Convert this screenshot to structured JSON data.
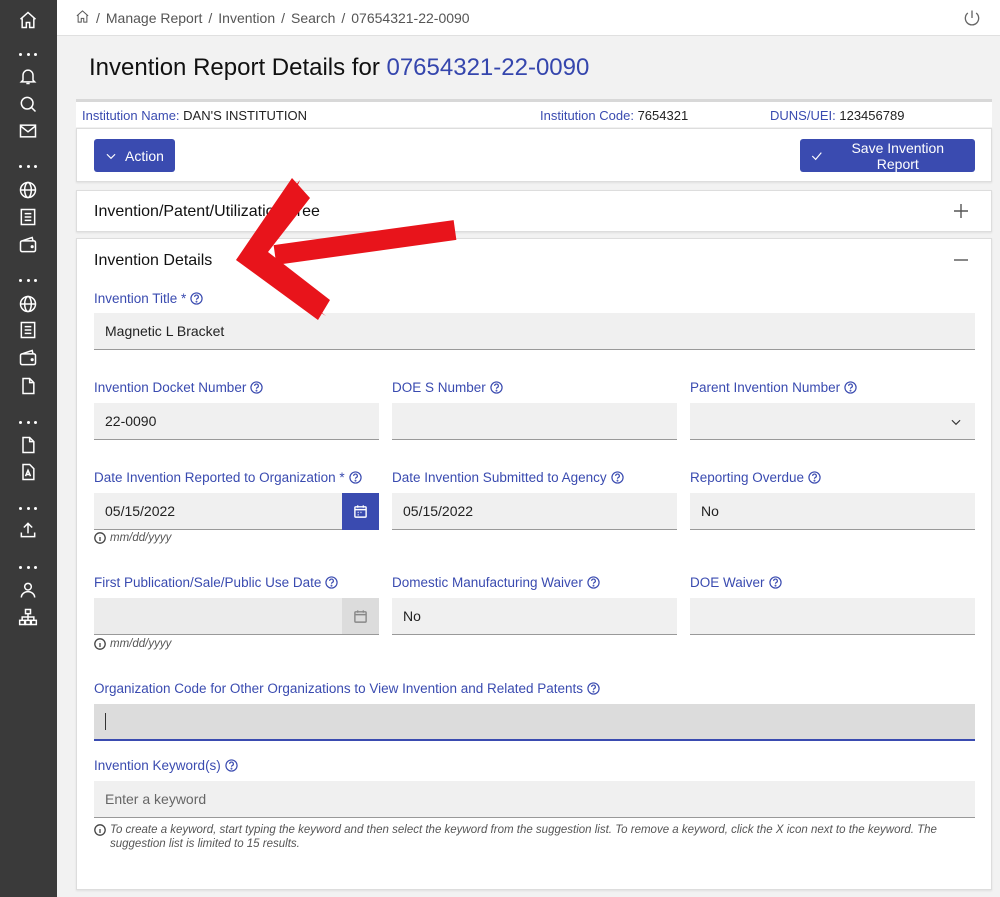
{
  "sidebar": {
    "icons": [
      "home-icon",
      "bell-icon",
      "search-chat-icon",
      "mail-icon",
      "globe-icon",
      "list-icon",
      "wallet-icon",
      "globe-icon",
      "list-icon",
      "wallet-icon",
      "document-icon",
      "document-icon",
      "pdf-icon",
      "upload-icon",
      "user-icon",
      "org-chart-icon"
    ]
  },
  "breadcrumb": {
    "items": [
      "Manage Report",
      "Invention",
      "Search",
      "07654321-22-0090"
    ],
    "separator": "/"
  },
  "page": {
    "title_prefix": "Invention Report Details for",
    "title_number": "07654321-22-0090"
  },
  "institution": {
    "name_label": "Institution Name:",
    "name_value": "DAN'S INSTITUTION",
    "code_label": "Institution Code:",
    "code_value": "7654321",
    "duns_label": "DUNS/UEI:",
    "duns_value": "123456789"
  },
  "actions": {
    "action_label": "Action",
    "save_label": "Save Invention Report"
  },
  "tree_panel": {
    "title": "Invention/Patent/Utilization Tree"
  },
  "details_panel": {
    "title": "Invention Details",
    "fields": {
      "invention_title": {
        "label": "Invention Title *",
        "value": "Magnetic L Bracket"
      },
      "docket_number": {
        "label": "Invention Docket Number",
        "value": "22-0090"
      },
      "doe_s_number": {
        "label": "DOE S Number",
        "value": ""
      },
      "parent_invention": {
        "label": "Parent Invention Number",
        "value": ""
      },
      "date_reported": {
        "label": "Date Invention Reported to Organization *",
        "value": "05/15/2022",
        "hint": "mm/dd/yyyy"
      },
      "date_submitted": {
        "label": "Date Invention Submitted to Agency",
        "value": "05/15/2022"
      },
      "reporting_overdue": {
        "label": "Reporting Overdue",
        "value": "No"
      },
      "first_publication": {
        "label": "First Publication/Sale/Public Use Date",
        "value": "",
        "hint": "mm/dd/yyyy"
      },
      "domestic_waiver": {
        "label": "Domestic Manufacturing Waiver",
        "value": "No"
      },
      "doe_waiver": {
        "label": "DOE Waiver",
        "value": ""
      },
      "org_code": {
        "label": "Organization Code for Other Organizations to View Invention and Related Patents",
        "value": ""
      },
      "keywords": {
        "label": "Invention Keyword(s)",
        "placeholder": "Enter a keyword",
        "hint_line1": "To create a keyword, start typing the keyword and then select the keyword from the suggestion list. To remove a keyword, click the X icon next to the keyword. The",
        "hint_line2": "suggestion list is limited to 15 results."
      }
    }
  },
  "colors": {
    "accent": "#3a4bb0",
    "sidebar": "#3a3a3a",
    "annotation_arrow": "#e8141b"
  }
}
